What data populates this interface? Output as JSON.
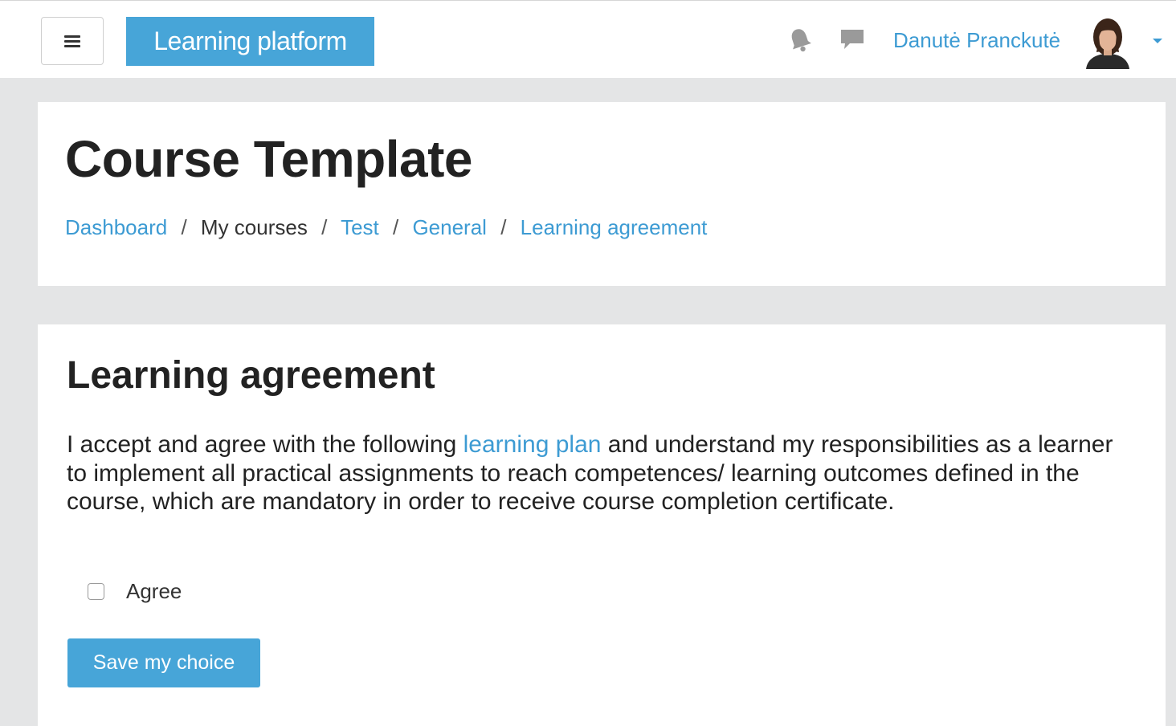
{
  "navbar": {
    "brand": "Learning platform",
    "user_name": "Danutė Pranckutė",
    "icons": {
      "menu": "hamburger-menu-icon",
      "notifications": "bell-icon",
      "messages": "chat-bubble-icon",
      "user_menu": "caret-down-icon"
    },
    "accent_color": "#47a5d8",
    "link_color": "#3d9bd3"
  },
  "header": {
    "title": "Course Template",
    "breadcrumb": [
      {
        "label": "Dashboard",
        "link": true
      },
      {
        "label": "My courses",
        "link": false
      },
      {
        "label": "Test",
        "link": true
      },
      {
        "label": "General",
        "link": true
      },
      {
        "label": "Learning agreement",
        "link": true
      }
    ],
    "separator": "/"
  },
  "main": {
    "heading": "Learning agreement",
    "text_before_link": "I accept and agree with the following ",
    "link_text": "learning plan",
    "text_after_link": " and understand my responsibilities as a learner to implement all practical assignments to reach competences/ learning outcomes defined in the course, which are mandatory in order to receive course completion certificate.",
    "checkbox_label": "Agree",
    "checkbox_checked": false,
    "save_button": "Save my choice"
  }
}
